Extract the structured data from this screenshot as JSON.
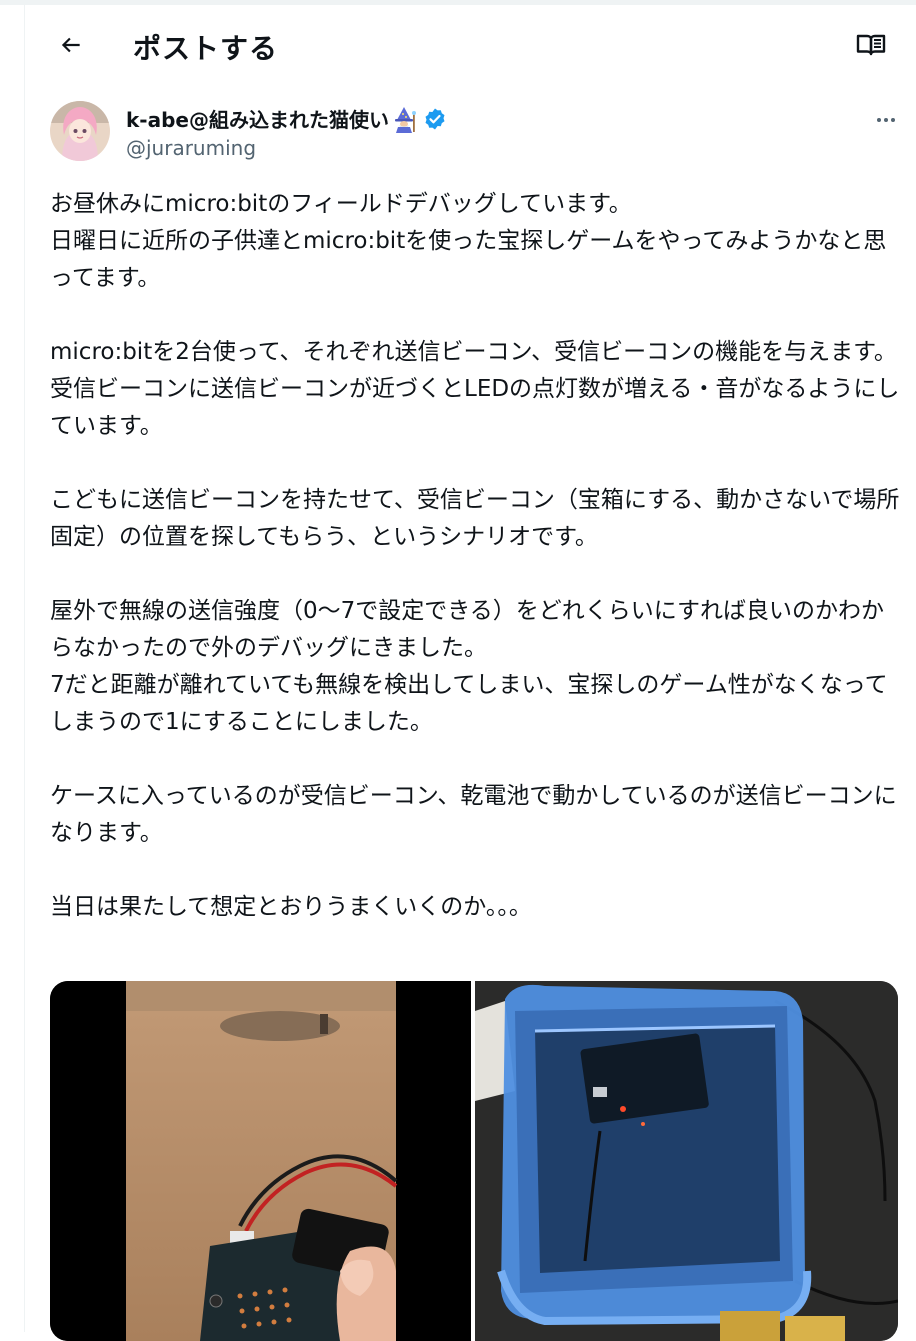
{
  "header": {
    "title": "ポストする",
    "back_icon": "arrow-left-icon",
    "reader_icon": "open-book-icon"
  },
  "author": {
    "display_name": "k-abe@組み込まれた猫使い",
    "handle": "@juraruming",
    "verified": true,
    "name_emoji": "wizard-icon",
    "verified_color": "#1d9bf0"
  },
  "tweet": {
    "paragraphs": [
      "お昼休みにmicro:bitのフィールドデバッグしています。\n日曜日に近所の子供達とmicro:bitを使った宝探しゲームをやってみようかなと思ってます。",
      "micro:bitを2台使って、それぞれ送信ビーコン、受信ビーコンの機能を与えます。\n受信ビーコンに送信ビーコンが近づくとLEDの点灯数が増える・音がなるようにしています。",
      "こどもに送信ビーコンを持たせて、受信ビーコン（宝箱にする、動かさないで場所固定）の位置を探してもらう、というシナリオです。",
      "屋外で無線の送信強度（0〜7で設定できる）をどれくらいにすれば良いのかわからなかったので外のデバッグにきました。\n7だと距離が離れていても無線を検出してしまい、宝探しのゲーム性がなくなってしまうので1にすることにしました。",
      "ケースに入っているのが受信ビーコン、乾電池で動かしているのが送信ビーコンになります。",
      "当日は果たして想定とおりうまくいくのか。。。"
    ]
  },
  "more_icon": "more-dots-icon"
}
